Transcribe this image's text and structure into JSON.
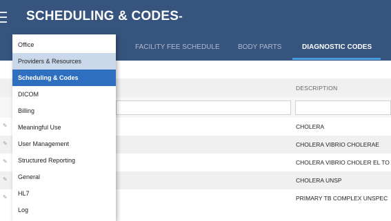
{
  "header": {
    "title": "SCHEDULING & CODES",
    "caret": "-"
  },
  "tabs": [
    {
      "label": "FACILITY FEE SCHEDULE",
      "active": false
    },
    {
      "label": "BODY PARTS",
      "active": false
    },
    {
      "label": "DIAGNOSTIC CODES",
      "active": true
    }
  ],
  "menu": {
    "items": [
      {
        "label": "Office"
      },
      {
        "label": "Providers & Resources",
        "state": "hover"
      },
      {
        "label": "Scheduling & Codes",
        "state": "selected"
      },
      {
        "label": "DICOM"
      },
      {
        "label": "Billing"
      },
      {
        "label": "Meaningful Use"
      },
      {
        "label": "User Management"
      },
      {
        "label": "Structured Reporting"
      },
      {
        "label": "General"
      },
      {
        "label": "HL7"
      },
      {
        "label": "Log"
      }
    ]
  },
  "table": {
    "columns": {
      "description": "DESCRIPTION"
    },
    "rows": [
      {
        "description": "CHOLERA"
      },
      {
        "description": "CHOLERA VIBRIO CHOLERAE"
      },
      {
        "description": "CHOLERA VIBRIO CHOLER EL TO"
      },
      {
        "description": "CHOLERA UNSP"
      },
      {
        "description": "PRIMARY TB COMPLEX UNSPEC"
      }
    ]
  },
  "colors": {
    "header_bg": "#37547e",
    "active_tab_underline": "#4a9de2",
    "menu_selected": "#2f6fbf",
    "menu_hover": "#c9d8ea"
  }
}
